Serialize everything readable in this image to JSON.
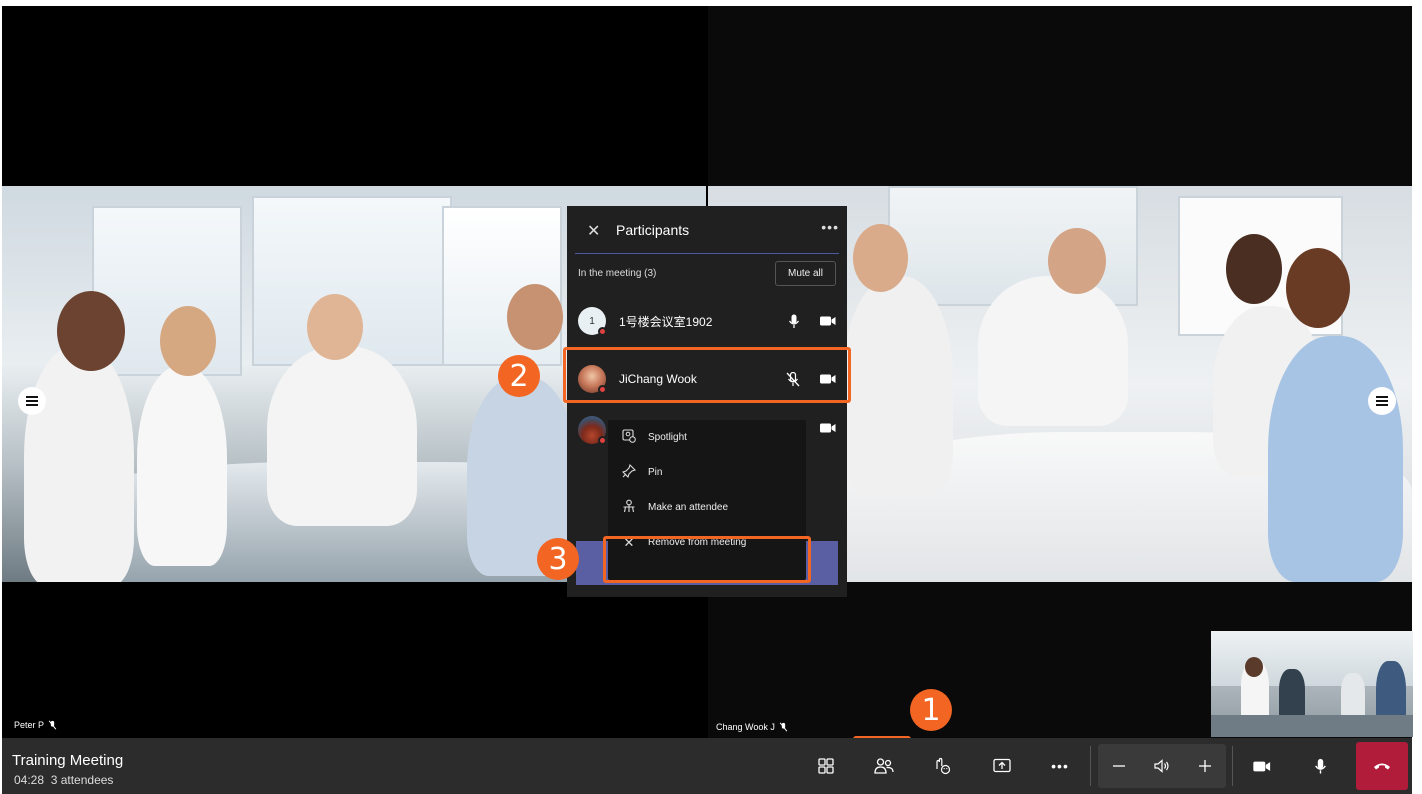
{
  "tiles": {
    "left_name": "Peter P",
    "right_name": "Chang Wook J"
  },
  "panel": {
    "title": "Participants",
    "section_label": "In the meeting (3)",
    "mute_all": "Mute all",
    "participants": [
      {
        "initial": "1",
        "name": "1号楼会议室1902",
        "muted": false
      },
      {
        "name": "JiChang Wook",
        "muted": true
      },
      {
        "name": "",
        "muted": false
      }
    ]
  },
  "context_menu": {
    "items": [
      "Spotlight",
      "Pin",
      "Make an attendee",
      "Remove from meeting"
    ]
  },
  "annotations": {
    "badge1": "1",
    "badge2": "2",
    "badge3": "3",
    "color": "#f26522"
  },
  "bottombar": {
    "title": "Training Meeting",
    "time": "04:28",
    "attendees": "3 attendees"
  }
}
